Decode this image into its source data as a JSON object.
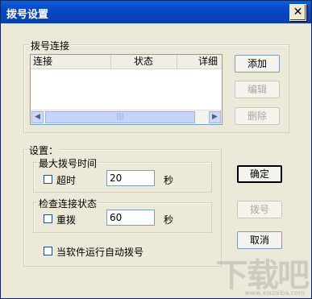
{
  "window": {
    "title": "拨号设置"
  },
  "dial_group": {
    "label": "拨号连接",
    "columns": [
      "连接",
      "状态",
      "详细"
    ],
    "add_label": "添加",
    "edit_label": "编辑",
    "delete_label": "删除"
  },
  "settings": {
    "label": "设置：",
    "max_dial": {
      "label": "最大拨号时间",
      "checkbox": "超时",
      "value": "20",
      "unit": "秒"
    },
    "check_conn": {
      "label": "检查连接状态",
      "checkbox": "重拨",
      "value": "60",
      "unit": "秒"
    },
    "auto_dial": "当软件运行自动拨号"
  },
  "buttons": {
    "ok": "确定",
    "dial": "拨号",
    "cancel": "取消"
  },
  "watermark": {
    "text": "下载吧",
    "url": "www.xiazaiba.com"
  }
}
